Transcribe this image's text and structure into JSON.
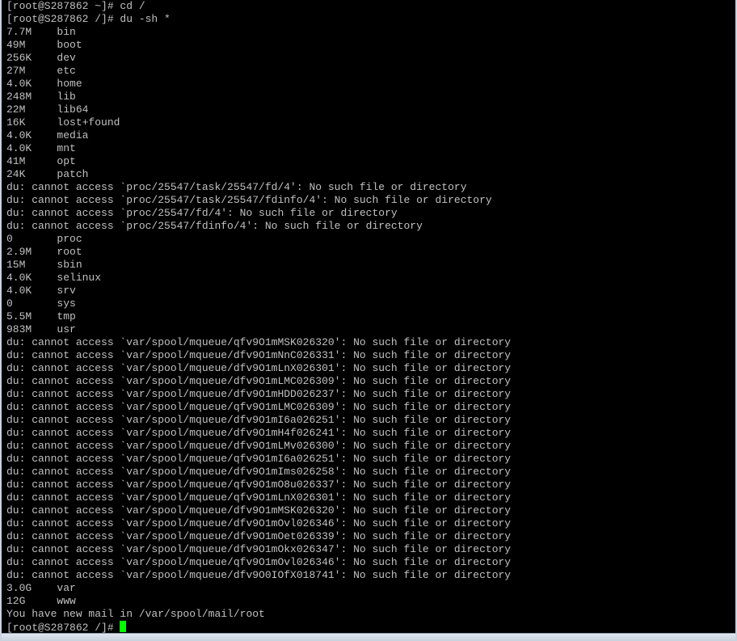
{
  "terminal": {
    "lines": [
      "[root@S287862 ~]# cd /",
      "[root@S287862 /]# du -sh *",
      "7.7M    bin",
      "49M     boot",
      "256K    dev",
      "27M     etc",
      "4.0K    home",
      "248M    lib",
      "22M     lib64",
      "16K     lost+found",
      "4.0K    media",
      "4.0K    mnt",
      "41M     opt",
      "24K     patch",
      "du: cannot access `proc/25547/task/25547/fd/4': No such file or directory",
      "du: cannot access `proc/25547/task/25547/fdinfo/4': No such file or directory",
      "du: cannot access `proc/25547/fd/4': No such file or directory",
      "du: cannot access `proc/25547/fdinfo/4': No such file or directory",
      "0       proc",
      "2.9M    root",
      "15M     sbin",
      "4.0K    selinux",
      "4.0K    srv",
      "0       sys",
      "5.5M    tmp",
      "983M    usr",
      "du: cannot access `var/spool/mqueue/qfv9O1mMSK026320': No such file or directory",
      "du: cannot access `var/spool/mqueue/dfv9O1mNnC026331': No such file or directory",
      "du: cannot access `var/spool/mqueue/dfv9O1mLnX026301': No such file or directory",
      "du: cannot access `var/spool/mqueue/dfv9O1mLMC026309': No such file or directory",
      "du: cannot access `var/spool/mqueue/dfv9O1mHDD026237': No such file or directory",
      "du: cannot access `var/spool/mqueue/qfv9O1mLMC026309': No such file or directory",
      "du: cannot access `var/spool/mqueue/dfv9O1mI6a026251': No such file or directory",
      "du: cannot access `var/spool/mqueue/dfv9O1mH4f026241': No such file or directory",
      "du: cannot access `var/spool/mqueue/dfv9O1mLMv026300': No such file or directory",
      "du: cannot access `var/spool/mqueue/qfv9O1mI6a026251': No such file or directory",
      "du: cannot access `var/spool/mqueue/dfv9O1mIms026258': No such file or directory",
      "du: cannot access `var/spool/mqueue/qfv9O1mO8u026337': No such file or directory",
      "du: cannot access `var/spool/mqueue/qfv9O1mLnX026301': No such file or directory",
      "du: cannot access `var/spool/mqueue/dfv9O1mMSK026320': No such file or directory",
      "du: cannot access `var/spool/mqueue/dfv9O1mOvl026346': No such file or directory",
      "du: cannot access `var/spool/mqueue/dfv9O1mOet026339': No such file or directory",
      "du: cannot access `var/spool/mqueue/dfv9O1mOkx026347': No such file or directory",
      "du: cannot access `var/spool/mqueue/qfv9O1mOvl026346': No such file or directory",
      "du: cannot access `var/spool/mqueue/dfv9O0IOfX018741': No such file or directory",
      "3.0G    var",
      "12G     www",
      "You have new mail in /var/spool/mail/root"
    ],
    "prompt": "[root@S287862 /]# ",
    "colors": {
      "background": "#000000",
      "text": "#c0c0c0",
      "cursor": "#00ff00"
    }
  }
}
